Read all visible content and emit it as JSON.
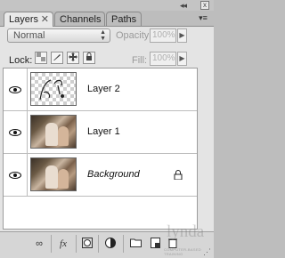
{
  "panel": {
    "tabs": [
      {
        "label": "Layers",
        "close": "✕",
        "active": true
      },
      {
        "label": "Channels",
        "active": false
      },
      {
        "label": "Paths",
        "active": false
      }
    ],
    "collapse_glyph": "◂◂",
    "close_glyph": "x",
    "menu_glyph": "▾≡"
  },
  "options": {
    "blend_mode": "Normal",
    "opacity_label": "Opacity:",
    "opacity_value": "100%",
    "lock_label": "Lock:",
    "fill_label": "Fill:",
    "fill_value": "100%"
  },
  "layers": [
    {
      "name": "Layer 2",
      "visible": true,
      "thumbnail": "transparent-sketch",
      "locked": false,
      "italic": false
    },
    {
      "name": "Layer 1",
      "visible": true,
      "thumbnail": "photo",
      "locked": false,
      "italic": false
    },
    {
      "name": "Background",
      "visible": true,
      "thumbnail": "photo",
      "locked": true,
      "italic": true
    }
  ],
  "toolbar": {
    "icons": [
      "link-icon",
      "fx-icon",
      "mask-icon",
      "adjustment-icon",
      "folder-icon",
      "new-layer-icon",
      "trash-icon"
    ],
    "fx_label": "fx"
  },
  "watermark": {
    "text": "lynda",
    "sub": "COMPUTER-BASED TRAINING"
  }
}
